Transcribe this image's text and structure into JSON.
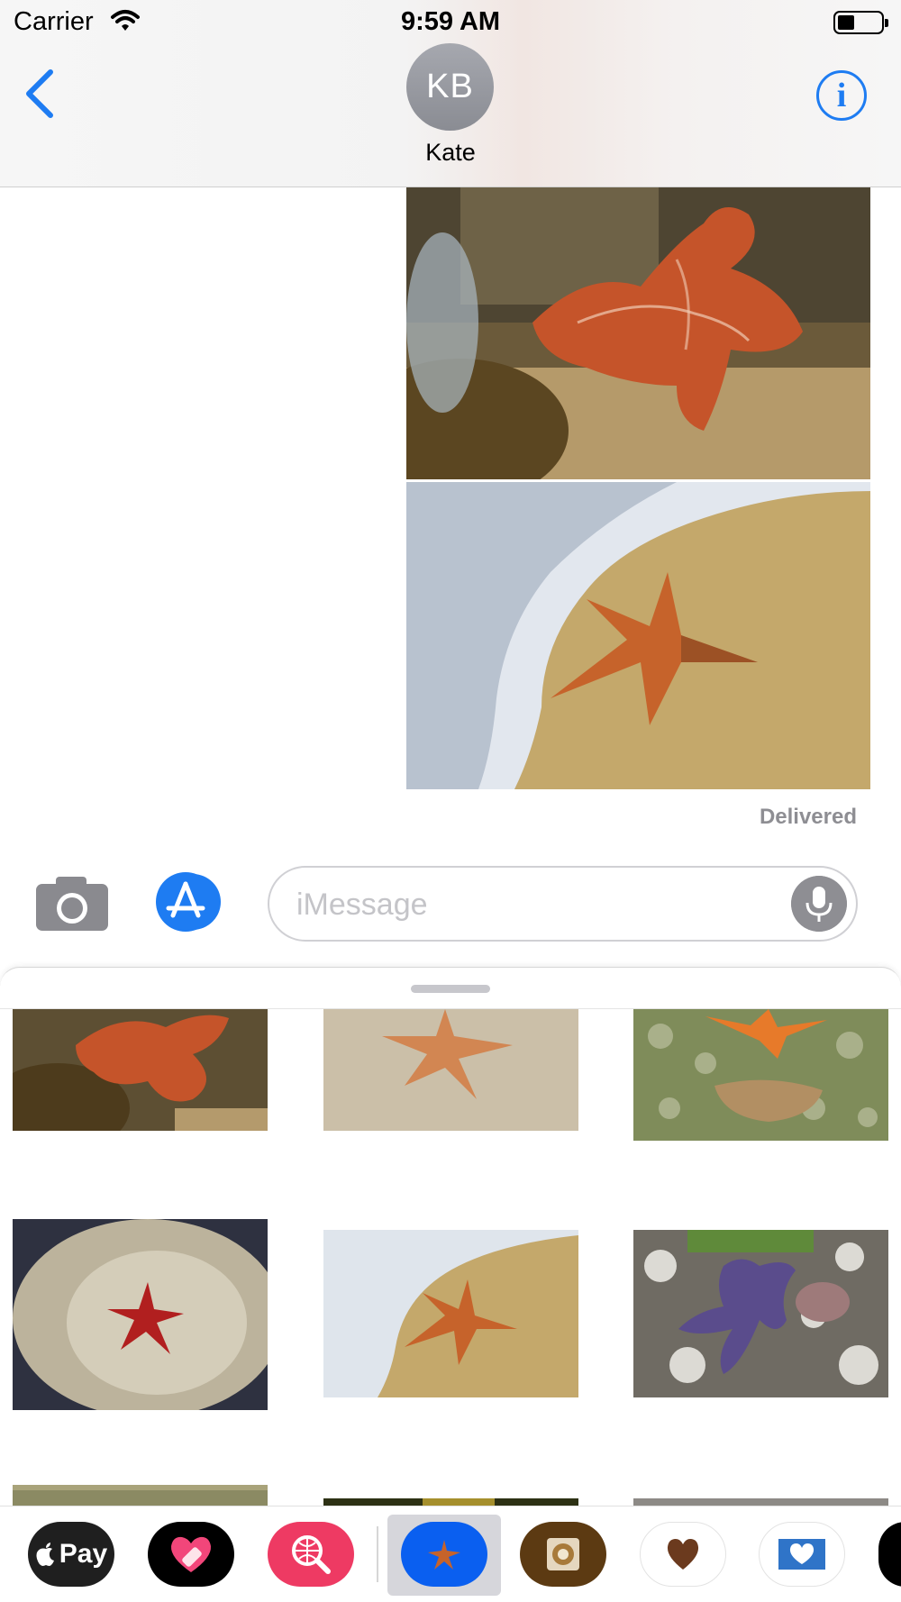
{
  "status_bar": {
    "carrier": "Carrier",
    "time": "9:59 AM"
  },
  "header": {
    "contact_initials": "KB",
    "contact_name": "Kate"
  },
  "transcript": {
    "delivered": "Delivered"
  },
  "compose": {
    "placeholder": "iMessage"
  },
  "app_strip": {
    "apple_pay_label": "Pay"
  },
  "colors": {
    "ios_blue": "#1E7CF2",
    "selected_app": "#0A5FF0",
    "gray": "#8E8E93"
  },
  "icons": [
    "back-chevron-icon",
    "info-icon",
    "camera-icon",
    "app-store-icon",
    "microphone-icon",
    "wifi-icon",
    "battery-icon"
  ]
}
